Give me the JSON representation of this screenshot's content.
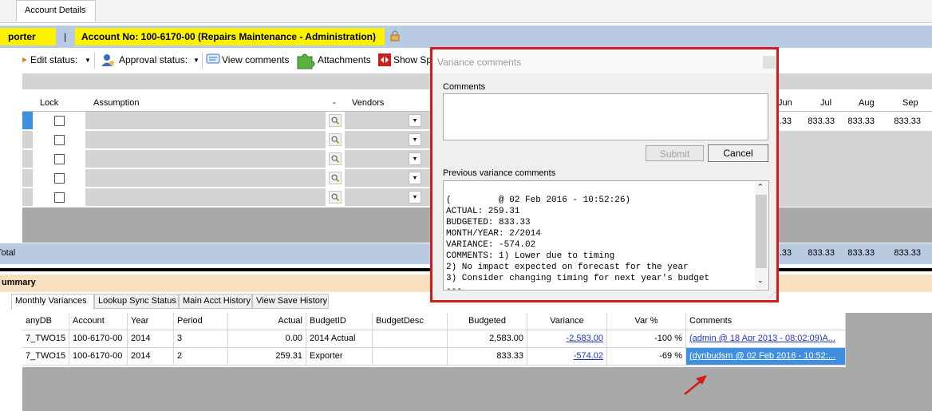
{
  "tab": {
    "label": "Account Details"
  },
  "header": {
    "exporter_label": "porter",
    "separator": "|",
    "account_label": "Account No: 100-6170-00 (Repairs  Maintenance - Administration)"
  },
  "toolbar": {
    "edit_status": "Edit status:",
    "approval_status": "Approval status:",
    "view_comments": "View comments",
    "attachments": "Attachments",
    "show_sp": "Show Sp"
  },
  "grid": {
    "headers": {
      "lock": "Lock",
      "assumption": "Assumption",
      "dash": "-",
      "vendors": "Vendors",
      "jun": "Jun",
      "jul": "Jul",
      "aug": "Aug",
      "sep": "Sep"
    },
    "row1_values": {
      "jun": ".33",
      "jul": "833.33",
      "aug": "833.33",
      "sep": "833.33"
    },
    "total_label": "Total",
    "total_values": {
      "jun": ".33",
      "jul": "833.33",
      "aug": "833.33",
      "sep": "833.33"
    }
  },
  "summary": {
    "title": "ummary",
    "tabs": [
      "Monthly Variances",
      "Lookup Sync Status",
      "Main Acct History",
      "View Save History"
    ],
    "columns": [
      "anyDB",
      "Account",
      "Year",
      "Period",
      "Actual",
      "BudgetID",
      "BudgetDesc",
      "Budgeted",
      "Variance",
      "Var %",
      "Comments"
    ],
    "rows": [
      {
        "db": "7_TWO15",
        "account": "100-6170-00",
        "year": "2014",
        "period": "3",
        "actual": "0.00",
        "budgetid": "2014 Actual",
        "budgetdesc": "",
        "budgeted": "2,583.00",
        "variance": "-2,583.00",
        "varpct": "-100 %",
        "comments": "(admin @ 18 Apr 2013 - 08:02:09)A..."
      },
      {
        "db": "7_TWO15",
        "account": "100-6170-00",
        "year": "2014",
        "period": "2",
        "actual": "259.31",
        "budgetid": "Exporter",
        "budgetdesc": "",
        "budgeted": "833.33",
        "variance": "-574.02",
        "varpct": "-69 %",
        "comments": "(dynbudsm @ 02 Feb 2016 - 10:52:..."
      }
    ]
  },
  "dialog": {
    "title": "Variance comments",
    "comments_label": "Comments",
    "comments_value": "",
    "submit": "Submit",
    "cancel": "Cancel",
    "previous_label": "Previous variance comments",
    "previous_lines": [
      "(         @ 02 Feb 2016 - 10:52:26)",
      "ACTUAL: 259.31",
      "BUDGETED: 833.33",
      "MONTH/YEAR: 2/2014",
      "VARIANCE: -574.02",
      "COMMENTS: 1) Lower due to timing",
      "2) No impact expected on forecast for the year",
      "3) Consider changing timing for next year's budget",
      "---"
    ]
  },
  "colors": {
    "highlight": "#fff200",
    "band": "#b9cbe2",
    "selection": "#3f8fe0",
    "annotation": "#d21c1c",
    "summary_band": "#f8dfbf"
  }
}
